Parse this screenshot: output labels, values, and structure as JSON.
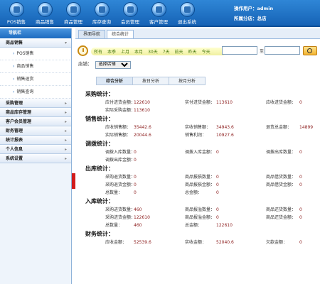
{
  "nav": [
    {
      "label": "POS销售",
      "icon": "pos-icon"
    },
    {
      "label": "商品销售",
      "icon": "sales-icon"
    },
    {
      "label": "商品管理",
      "icon": "product-icon"
    },
    {
      "label": "库存查询",
      "icon": "inventory-icon"
    },
    {
      "label": "会员管理",
      "icon": "member-icon"
    },
    {
      "label": "客户管理",
      "icon": "customer-icon"
    },
    {
      "label": "退出系统",
      "icon": "exit-icon"
    }
  ],
  "user": {
    "operator_label": "操作用户：",
    "operator": "admin",
    "branch_label": "所属分店：",
    "branch": "总店"
  },
  "sidebar": {
    "title": "导航栏",
    "groups": [
      {
        "label": "商品销售",
        "subs": [
          "POS销售",
          "商品销售",
          "销售退货",
          "销售查询"
        ]
      },
      {
        "label": "采购管理",
        "subs": []
      },
      {
        "label": "商品库存管理",
        "subs": []
      },
      {
        "label": "客户会员管理",
        "subs": []
      },
      {
        "label": "财务管理",
        "subs": []
      },
      {
        "label": "统计报表",
        "subs": []
      },
      {
        "label": "个人信息",
        "subs": []
      },
      {
        "label": "系统设置",
        "subs": []
      }
    ]
  },
  "tabs": [
    "界面导航",
    "综合统计"
  ],
  "filter": {
    "quick": [
      "所有",
      "本季",
      "上月",
      "本月",
      "30天",
      "7天",
      "前天",
      "昨天",
      "今天"
    ],
    "date_sep": "至"
  },
  "store": {
    "label": "店铺：",
    "select": "选择店铺"
  },
  "subtabs": [
    "综合分析",
    "按日分析",
    "按月分析"
  ],
  "sections": [
    {
      "title": "采购统计：",
      "rows": [
        [
          {
            "l": "应付进货金额：",
            "v": "122610"
          },
          {
            "l": "实付进货金额：",
            "v": "113610"
          },
          {
            "l": "应收进货金额：",
            "v": "0"
          }
        ],
        [
          {
            "l": "实际采购金额：",
            "v": "113610"
          }
        ]
      ]
    },
    {
      "title": "销售统计：",
      "rows": [
        [
          {
            "l": "应收销售额：",
            "v": "35442.6"
          },
          {
            "l": "实收销售额：",
            "v": "34943.6"
          },
          {
            "l": "退货总金额：",
            "v": "14899"
          }
        ],
        [
          {
            "l": "实际销售额：",
            "v": "20044.6"
          },
          {
            "l": "销售利润：",
            "v": "10927.6"
          }
        ]
      ]
    },
    {
      "title": "调拨统计：",
      "rows": [
        [
          {
            "l": "调拨入库数量：",
            "v": "0"
          },
          {
            "l": "调拨入库金额：",
            "v": "0"
          },
          {
            "l": "调拨出库数量：",
            "v": "0"
          }
        ],
        [
          {
            "l": "调拨出库金额：",
            "v": "0"
          }
        ]
      ]
    },
    {
      "title": "出库统计：",
      "rows": [
        [
          {
            "l": "采购退货数量：",
            "v": "0"
          },
          {
            "l": "商品报损数量：",
            "v": "0"
          },
          {
            "l": "商品借货数量：",
            "v": "0"
          }
        ],
        [
          {
            "l": "采购退货金额：",
            "v": "0"
          },
          {
            "l": "商品报损金额：",
            "v": "0"
          },
          {
            "l": "商品借货金额：",
            "v": "0"
          }
        ],
        [
          {
            "l": "总数量：",
            "v": "0"
          },
          {
            "l": "总金额：",
            "v": "0"
          }
        ]
      ]
    },
    {
      "title": "入库统计：",
      "rows": [
        [
          {
            "l": "采购进货数量：",
            "v": "460"
          },
          {
            "l": "商品报溢数量：",
            "v": "0"
          },
          {
            "l": "商品还货数量：",
            "v": "0"
          }
        ],
        [
          {
            "l": "采购进货金额：",
            "v": "122610"
          },
          {
            "l": "商品报溢金额：",
            "v": "0"
          },
          {
            "l": "商品还货金额：",
            "v": "0"
          }
        ],
        [
          {
            "l": "总数量：",
            "v": "460"
          },
          {
            "l": "总金额：",
            "v": "122610"
          }
        ]
      ]
    },
    {
      "title": "财务统计：",
      "rows": [
        [
          {
            "l": "应收金额：",
            "v": "52539.6"
          },
          {
            "l": "实收金额：",
            "v": "52040.6"
          },
          {
            "l": "欠款金额：",
            "v": "0"
          }
        ]
      ]
    }
  ]
}
